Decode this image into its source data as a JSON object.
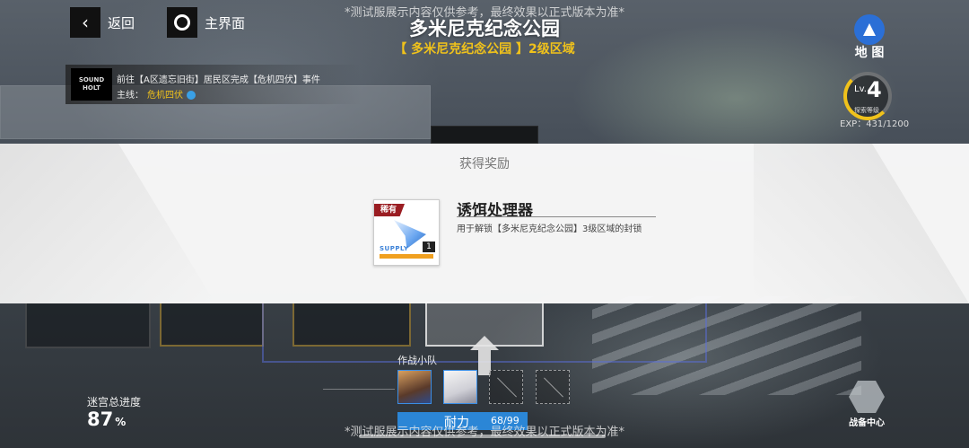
{
  "watermark": "*测试服展示内容仅供参考，最终效果以正式版本为准*",
  "nav": {
    "back_label": "返回",
    "home_label": "主界面"
  },
  "title": "多米尼克纪念公园",
  "subtitle": "【 多米尼克纪念公园 】2级区域",
  "map": {
    "label": "地 图",
    "icon": "navigation-arrow-icon"
  },
  "level": {
    "prefix": "Lv.",
    "value": "4",
    "desc": "探索等级",
    "exp": "EXP：431/1200"
  },
  "quest": {
    "logo_text_top": "SOUND",
    "logo_text_bottom": "HOLT",
    "line1": "前往【A区遗忘旧街】居民区完成【危机四伏】事件",
    "line2_prefix": "主线：",
    "line2_highlight": "危机四伏"
  },
  "reward": {
    "title": "获得奖励",
    "rarity": "稀有",
    "item_name": "诱饵处理器",
    "item_desc": "用于解锁【多米尼克纪念公园】3级区域的封锁",
    "item_count": "1",
    "item_tag": "SUPPLY"
  },
  "progress": {
    "label": "迷宫总进度",
    "value": "87",
    "unit": "%"
  },
  "squad": {
    "label": "作战小队"
  },
  "stamina": {
    "label": "耐力",
    "value": "68/99"
  },
  "battle_center": {
    "label": "战备中心"
  },
  "colors": {
    "accent_gold": "#f0c21b",
    "accent_blue": "#2b86d6",
    "rarity_red": "#9a1d22"
  }
}
